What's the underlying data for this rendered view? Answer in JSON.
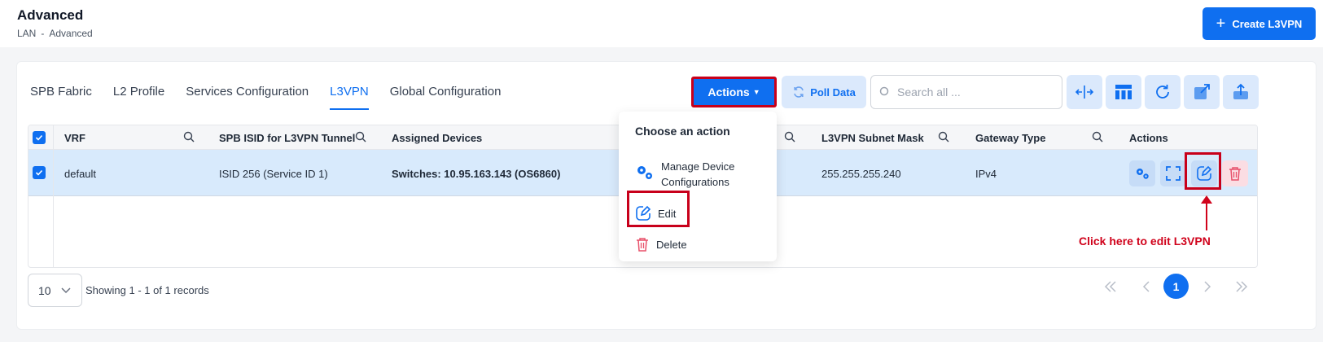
{
  "header": {
    "title": "Advanced",
    "breadcrumb": [
      "LAN",
      "-",
      "Advanced"
    ],
    "create_button": "Create L3VPN"
  },
  "tabs": [
    {
      "label": "SPB Fabric",
      "active": false
    },
    {
      "label": "L2 Profile",
      "active": false
    },
    {
      "label": "Services Configuration",
      "active": false
    },
    {
      "label": "L3VPN",
      "active": true
    },
    {
      "label": "Global Configuration",
      "active": false
    }
  ],
  "toolbar": {
    "actions_label": "Actions",
    "poll_label": "Poll Data",
    "search_placeholder": "Search all ...",
    "icons": [
      "resize-columns-icon",
      "table-layout-icon",
      "refresh-icon",
      "export-icon",
      "upload-icon"
    ]
  },
  "table": {
    "columns": [
      "VRF",
      "SPB ISID for L3VPN Tunnel",
      "Assigned Devices",
      "L3VPN Subnet Mask",
      "Gateway Type",
      "Actions"
    ],
    "rows": [
      {
        "vrf": "default",
        "isid": "ISID 256 (Service ID 1)",
        "devices": "Switches: 10.95.163.143 (OS6860)",
        "subnet_mask": "255.255.255.240",
        "gateway_type": "IPv4",
        "selected": true
      }
    ]
  },
  "dropdown": {
    "title": "Choose an action",
    "items": [
      {
        "label": "Manage Device Configurations",
        "icon": "gears-icon"
      },
      {
        "label": "Edit",
        "icon": "edit-icon"
      },
      {
        "label": "Delete",
        "icon": "trash-icon"
      }
    ]
  },
  "annotation": "Click here to edit L3VPN",
  "pagination": {
    "page_size": "10",
    "records_text": "Showing 1 - 1 of 1 records",
    "current_page": "1"
  },
  "colors": {
    "primary": "#0f6ff0",
    "highlight_red": "#c8001b",
    "row_selected": "#d8eafc",
    "danger": "#e8506a"
  }
}
